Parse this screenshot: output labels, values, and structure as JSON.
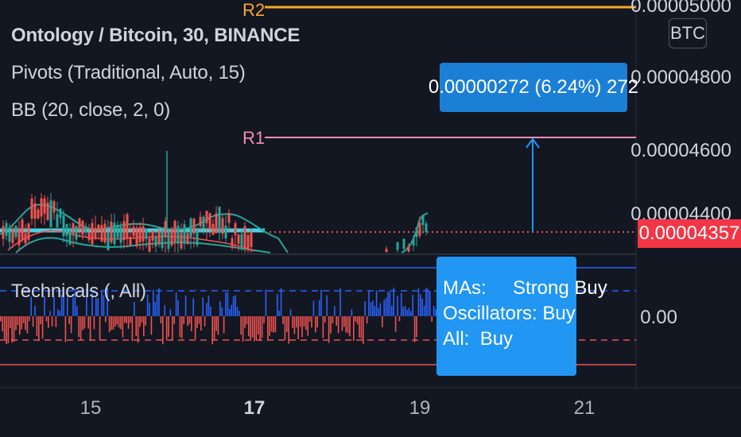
{
  "legend": {
    "symbol": "Ontology / Bitcoin, 30, BINANCE",
    "pivots": "Pivots (Traditional, Auto, 15)",
    "bb": "BB (20, close, 2, 0)",
    "technicals": "Technicals (, All)"
  },
  "price_scale": {
    "labels": [
      "0.00005000",
      "0.00004800",
      "0.00004600",
      "0.00004400"
    ],
    "current_price": "0.00004357",
    "currency_button": "BTC"
  },
  "indicator_scale": {
    "label": "0.00"
  },
  "pivots": {
    "r1": "R1",
    "r2": "R2"
  },
  "measure": {
    "text": "0.00000272 (6.24%) 272"
  },
  "technicals_panel": {
    "mas_label": "MAs:",
    "mas_value": "Strong Buy",
    "oscillators_label": "Oscillators:",
    "oscillators_value": "Buy",
    "all_label": "All:",
    "all_value": "Buy"
  },
  "time_axis": {
    "ticks": [
      {
        "label": "15",
        "bold": false
      },
      {
        "label": "17",
        "bold": true
      },
      {
        "label": "19",
        "bold": false
      },
      {
        "label": "21",
        "bold": false
      }
    ]
  },
  "colors": {
    "background": "#131722",
    "up": "#26a69a",
    "down": "#ef5350",
    "bb_band": "#26a69a",
    "bb_basis": "#ef5350",
    "r1": "#f48fb1",
    "r2": "#f9a825",
    "pivot_line": "#4dd0e1",
    "measure": "#2196f3",
    "price_badge": "#f23645"
  }
}
